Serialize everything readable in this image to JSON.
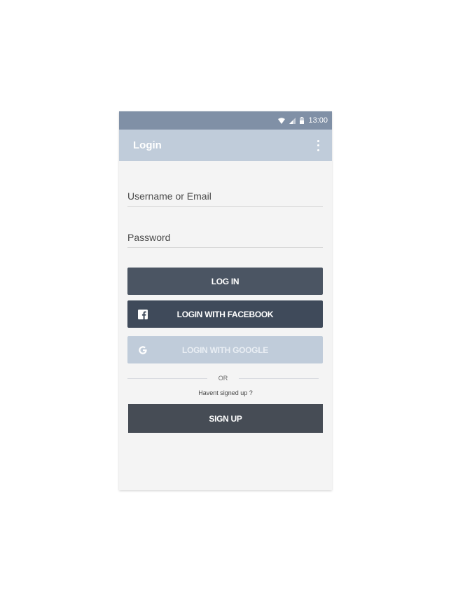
{
  "status_bar": {
    "time": "13:00",
    "icons": [
      "wifi-icon",
      "signal-icon",
      "battery-icon"
    ],
    "background": "#8090a6"
  },
  "app_bar": {
    "title": "Login",
    "menu_icon": "more-vertical-icon",
    "background": "#c0ccda"
  },
  "form": {
    "username_placeholder": "Username or Email",
    "username_value": "",
    "password_placeholder": "Password",
    "password_value": ""
  },
  "buttons": {
    "login_label": "LOG IN",
    "facebook_label": "LOGIN WITH FACEBOOK",
    "facebook_icon": "facebook-icon",
    "google_label": "LOGIN WITH GOOGLE",
    "google_icon": "google-icon",
    "signup_label": "SIGN UP"
  },
  "divider": {
    "text": "OR"
  },
  "signup_prompt": "Havent signed up ?",
  "colors": {
    "login_button": "#4b5563",
    "facebook_button": "#3f4a5a",
    "google_button": "#c0ccda",
    "signup_button": "#464c55",
    "screen_background": "#f4f4f4"
  }
}
